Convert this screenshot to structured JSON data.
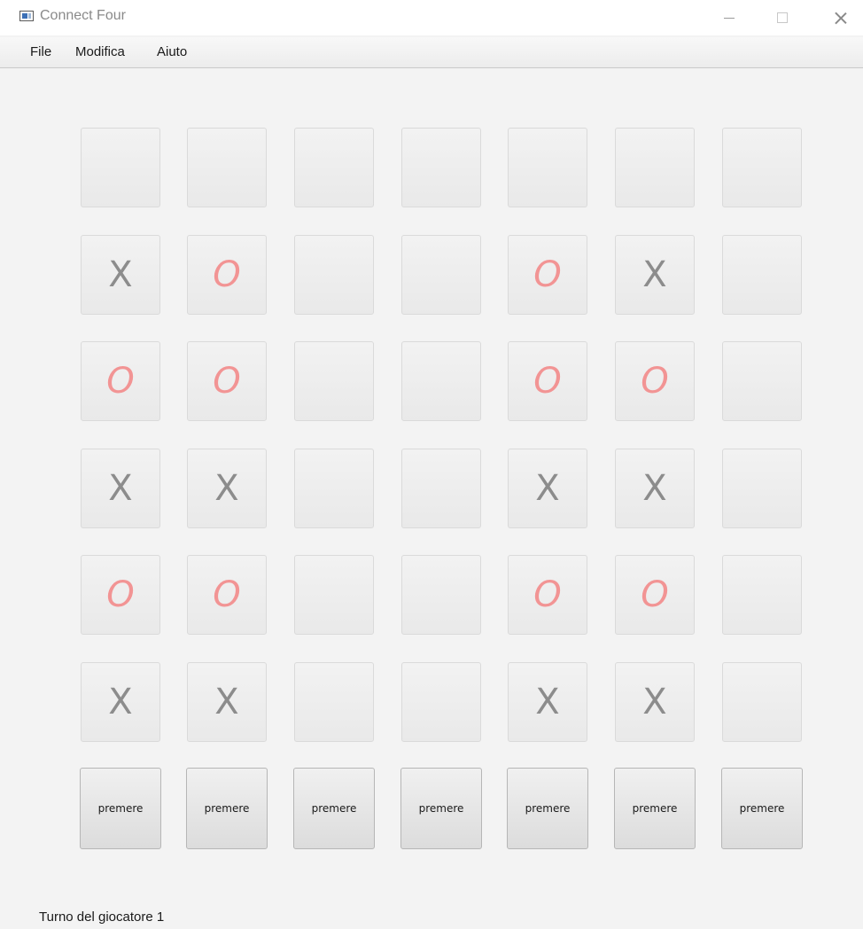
{
  "window": {
    "title": "Connect Four",
    "icon": "app-window-icon"
  },
  "menu": {
    "items": [
      {
        "label": "File"
      },
      {
        "label": "Modifica"
      },
      {
        "label": "Aiuto"
      }
    ]
  },
  "board": {
    "columns": 7,
    "rows": 6,
    "cells": [
      [
        "",
        "",
        "",
        "",
        "",
        "",
        ""
      ],
      [
        "X",
        "O",
        "",
        "",
        "O",
        "X",
        ""
      ],
      [
        "O",
        "O",
        "",
        "",
        "O",
        "O",
        ""
      ],
      [
        "X",
        "X",
        "",
        "",
        "X",
        "X",
        ""
      ],
      [
        "O",
        "O",
        "",
        "",
        "O",
        "O",
        ""
      ],
      [
        "X",
        "X",
        "",
        "",
        "X",
        "X",
        ""
      ]
    ],
    "drop_button_label": "premere",
    "colors": {
      "x": "#8c8c8c",
      "o": "#f29494"
    }
  },
  "status": {
    "text": "Turno del giocatore 1"
  }
}
